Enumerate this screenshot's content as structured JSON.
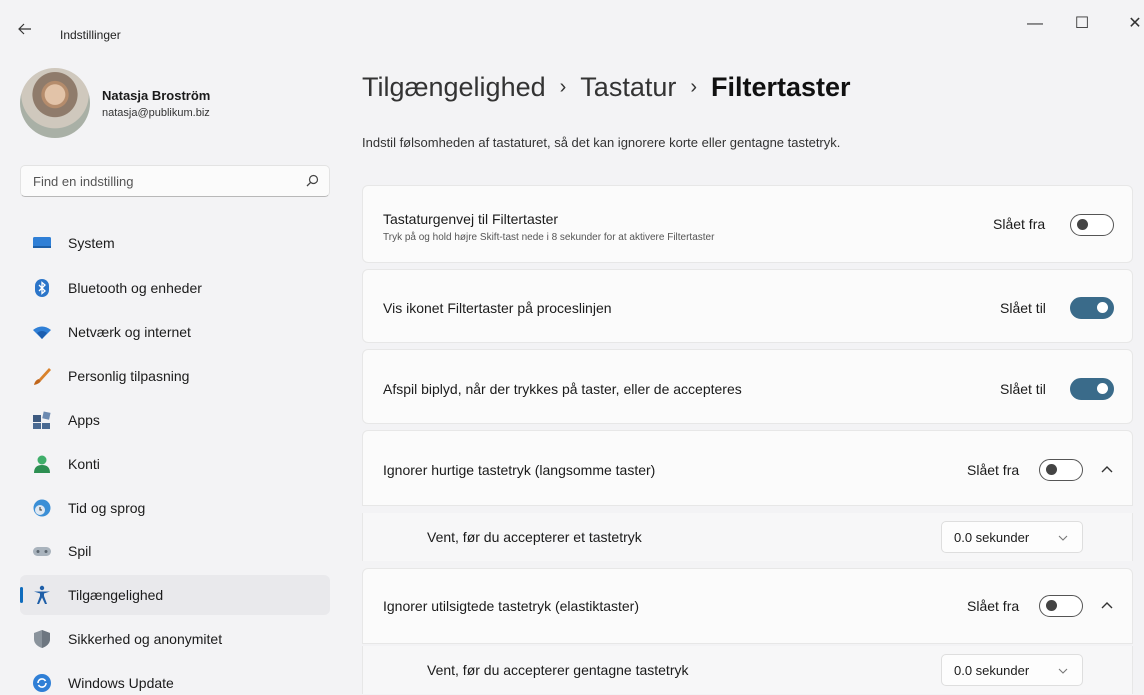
{
  "titlebar": {
    "back_icon": "back-arrow-icon",
    "title": "Indstillinger",
    "minimize_glyph": "—",
    "maximize_glyph": "☐",
    "close_glyph": "✕"
  },
  "user": {
    "name": "Natasja Broström",
    "email": "natasja@publikum.biz"
  },
  "search": {
    "placeholder": "Find en indstilling",
    "icon": "search-icon"
  },
  "sidebar": {
    "items": [
      {
        "label": "System",
        "icon": "monitor-icon"
      },
      {
        "label": "Bluetooth og enheder",
        "icon": "bluetooth-icon"
      },
      {
        "label": "Netværk og internet",
        "icon": "wifi-icon"
      },
      {
        "label": "Personlig tilpasning",
        "icon": "brush-icon"
      },
      {
        "label": "Apps",
        "icon": "apps-icon"
      },
      {
        "label": "Konti",
        "icon": "person-icon"
      },
      {
        "label": "Tid og sprog",
        "icon": "globe-clock-icon"
      },
      {
        "label": "Spil",
        "icon": "gamepad-icon"
      },
      {
        "label": "Tilgængelighed",
        "icon": "accessibility-icon",
        "active": true
      },
      {
        "label": "Sikkerhed og anonymitet",
        "icon": "shield-icon"
      },
      {
        "label": "Windows Update",
        "icon": "update-icon"
      }
    ]
  },
  "breadcrumb": {
    "items": [
      "Tilgængelighed",
      "Tastatur",
      "Filtertaster"
    ],
    "separator": "›"
  },
  "subtitle": "Indstil følsomheden af tastaturet, så det kan ignorere korte eller gentagne tastetryk.",
  "settings": {
    "shortcut": {
      "title": "Tastaturgenvej til Filtertaster",
      "description": "Tryk på og hold højre Skift-tast nede i 8 sekunder for at aktivere Filtertaster",
      "state_label": "Slået fra",
      "on": false
    },
    "show_icon": {
      "title": "Vis ikonet Filtertaster på proceslinjen",
      "state_label": "Slået til",
      "on": true
    },
    "beep": {
      "title": "Afspil biplyd, når der trykkes på taster, eller de accepteres",
      "state_label": "Slået til",
      "on": true
    },
    "slow_keys": {
      "title": "Ignorer hurtige tastetryk (langsomme taster)",
      "state_label": "Slået fra",
      "on": false,
      "sub_label": "Vent, før du accepterer et tastetryk",
      "sub_value": "0.0 sekunder"
    },
    "bounce_keys": {
      "title": "Ignorer utilsigtede tastetryk (elastiktaster)",
      "state_label": "Slået fra",
      "on": false,
      "sub_label": "Vent, før du accepterer gentagne tastetryk",
      "sub_value": "0.0 sekunder"
    }
  },
  "colors": {
    "accent": "#0f6cbd",
    "toggle_on": "#3a6b8a",
    "background": "#f3f3f5",
    "card": "#fbfbfb"
  }
}
